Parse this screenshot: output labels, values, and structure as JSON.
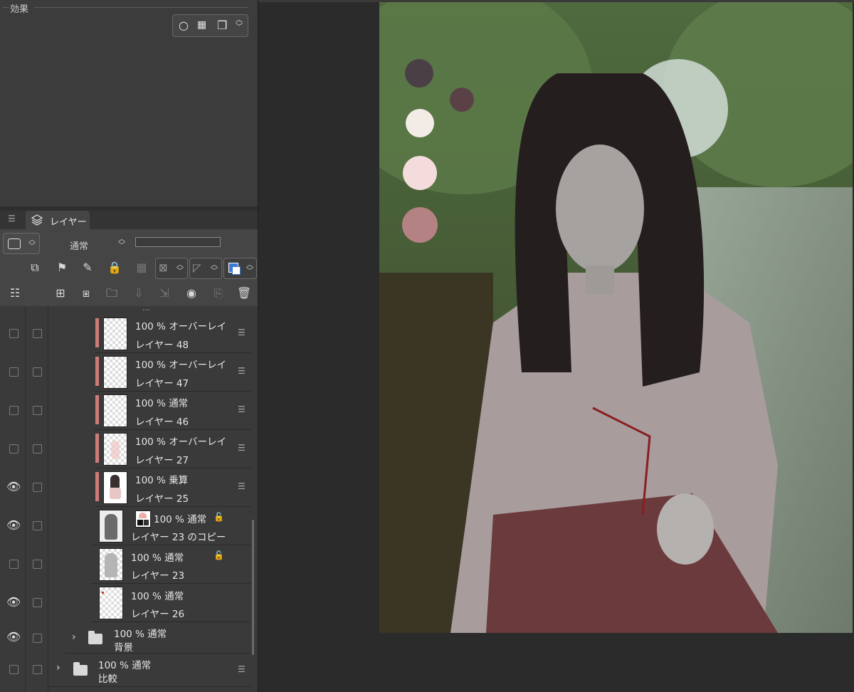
{
  "effects": {
    "title": "効果"
  },
  "layer_panel": {
    "tab_label": "レイヤー",
    "blend_mode": "通常",
    "partial_label": "…",
    "layers": [
      {
        "opacity": "100 %",
        "mode": "オーバーレイ",
        "name": "レイヤー 48",
        "visible": false
      },
      {
        "opacity": "100 %",
        "mode": "オーバーレイ",
        "name": "レイヤー 47",
        "visible": false
      },
      {
        "opacity": "100 %",
        "mode": "通常",
        "name": "レイヤー 46",
        "visible": false
      },
      {
        "opacity": "100 %",
        "mode": "オーバーレイ",
        "name": "レイヤー 27",
        "visible": false
      },
      {
        "opacity": "100 %",
        "mode": "乗算",
        "name": "レイヤー 25",
        "visible": true
      },
      {
        "opacity": "100 %",
        "mode": "通常",
        "name": "レイヤー 23 のコピー",
        "visible": true
      },
      {
        "opacity": "100 %",
        "mode": "通常",
        "name": "レイヤー 23",
        "visible": false
      },
      {
        "opacity": "100 %",
        "mode": "通常",
        "name": "レイヤー 26",
        "visible": true
      }
    ],
    "folders": [
      {
        "opacity": "100 %",
        "mode": "通常",
        "name": "背景",
        "visible": true
      },
      {
        "opacity": "100 %",
        "mode": "通常",
        "name": "比較",
        "visible": false
      }
    ]
  },
  "palette_swatches": [
    "#4a3f45",
    "#5a4145",
    "#f3ece6",
    "#f5dcdc",
    "#b48283"
  ],
  "colors": {
    "clip_bar": "#d07a78",
    "panel_bg": "#3a3a3a",
    "accent_blue": "#3a7ad9"
  }
}
